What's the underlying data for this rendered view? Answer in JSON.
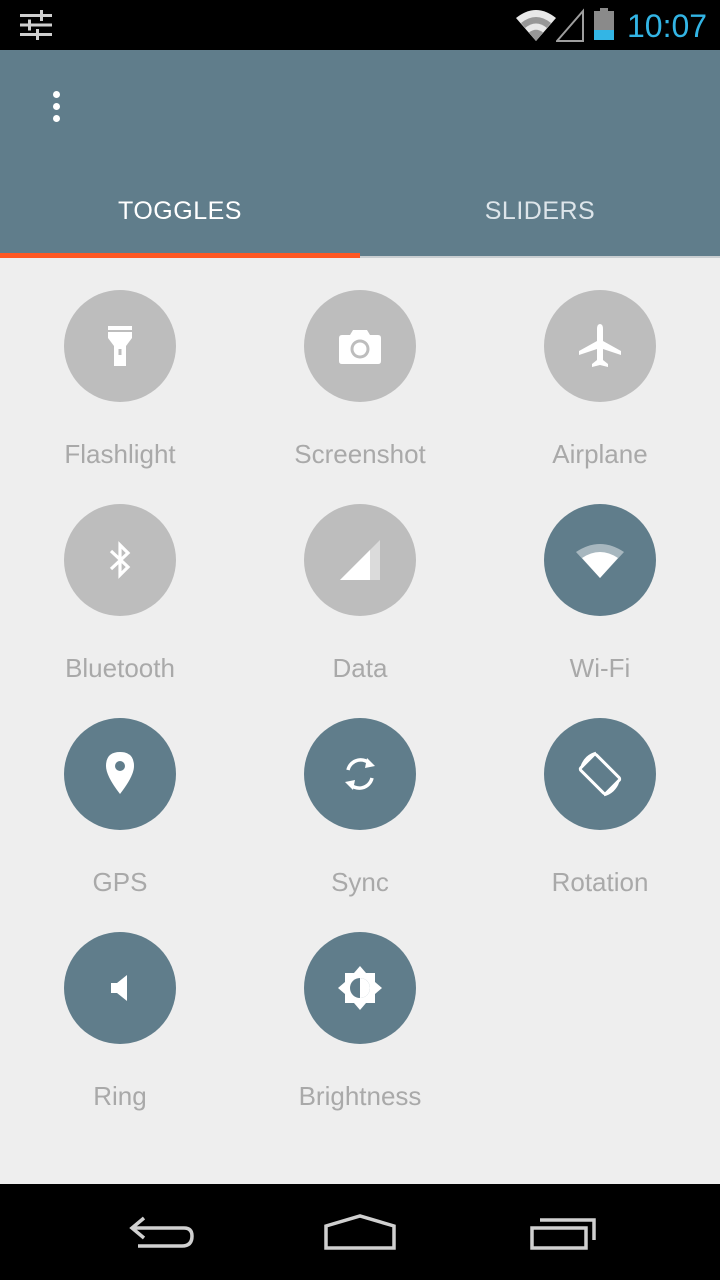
{
  "status_bar": {
    "time": "10:07",
    "left_icon": "tune-sliders-icon",
    "wifi_icon": "wifi-icon",
    "signal_icon": "cell-signal-icon",
    "battery_icon": "battery-icon",
    "time_color": "#33b5e5"
  },
  "app_bar": {
    "color": "#607d8b",
    "overflow_icon": "more-vert-icon",
    "tabs": [
      {
        "label": "TOGGLES",
        "active": true
      },
      {
        "label": "SLIDERS",
        "active": false
      }
    ],
    "indicator_color": "#ff5722"
  },
  "toggles": [
    {
      "label": "Flashlight",
      "icon": "flashlight-icon",
      "state": "off"
    },
    {
      "label": "Screenshot",
      "icon": "camera-icon",
      "state": "off"
    },
    {
      "label": "Airplane",
      "icon": "airplane-icon",
      "state": "off"
    },
    {
      "label": "Bluetooth",
      "icon": "bluetooth-icon",
      "state": "off"
    },
    {
      "label": "Data",
      "icon": "cell-signal-icon",
      "state": "off"
    },
    {
      "label": "Wi-Fi",
      "icon": "wifi-icon",
      "state": "on"
    },
    {
      "label": "GPS",
      "icon": "location-pin-icon",
      "state": "on"
    },
    {
      "label": "Sync",
      "icon": "sync-icon",
      "state": "on"
    },
    {
      "label": "Rotation",
      "icon": "screen-rotation-icon",
      "state": "on"
    },
    {
      "label": "Ring",
      "icon": "speaker-icon",
      "state": "on"
    },
    {
      "label": "Brightness",
      "icon": "brightness-icon",
      "state": "on"
    }
  ],
  "colors": {
    "toggle_on": "#607d8b",
    "toggle_off": "#bdbdbd",
    "background": "#eeeeee",
    "label": "#a9a9a9"
  },
  "nav_bar": {
    "back_icon": "back-icon",
    "home_icon": "home-icon",
    "recents_icon": "recents-icon"
  }
}
